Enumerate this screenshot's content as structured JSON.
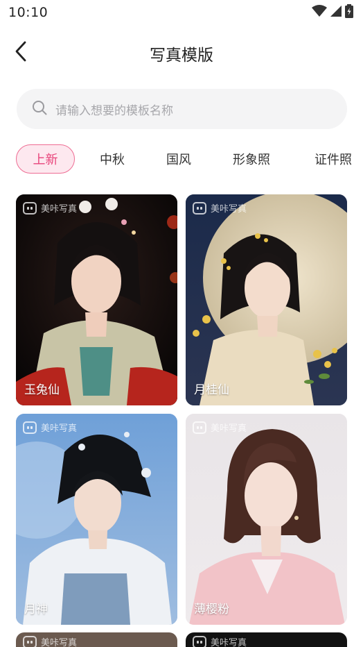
{
  "status_bar": {
    "time": "10:10"
  },
  "header": {
    "title": "写真模版"
  },
  "search": {
    "placeholder": "请输入想要的模板名称"
  },
  "tabs": [
    {
      "label": "上新",
      "active": true
    },
    {
      "label": "中秋",
      "active": false
    },
    {
      "label": "国风",
      "active": false
    },
    {
      "label": "形象照",
      "active": false
    },
    {
      "label": "证件照",
      "active": false
    }
  ],
  "watermark": "美咔写真",
  "cards": [
    {
      "label": "玉兔仙"
    },
    {
      "label": "月桂仙"
    },
    {
      "label": "月神"
    },
    {
      "label": "薄樱粉"
    }
  ],
  "colors": {
    "accent": "#e8437a",
    "accent_bg": "#fde8ef",
    "search_bg": "#f4f4f5"
  }
}
